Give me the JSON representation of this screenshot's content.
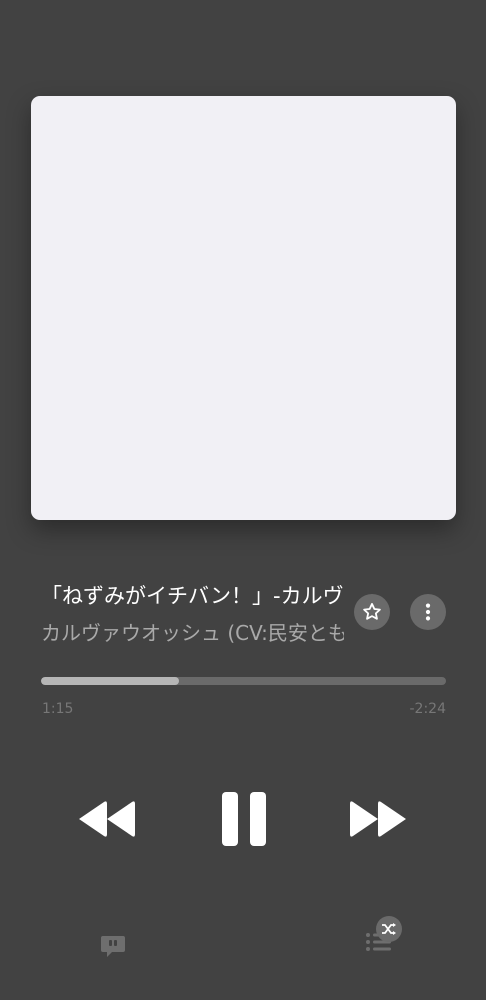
{
  "now_playing": {
    "title": "「ねずみがイチバン！」-カルヴァウオッシュ",
    "artist": "カルヴァウオッシュ (CV:民安ともえ)",
    "artwork_color": "#f1f0f5"
  },
  "progress": {
    "elapsed": "1:15",
    "remaining": "-2:24",
    "fraction": 0.34
  },
  "controls": {
    "favorite_icon": "star-icon",
    "more_icon": "more-vertical-icon",
    "rewind_icon": "rewind-icon",
    "pause_icon": "pause-icon",
    "fast_forward_icon": "fast-forward-icon",
    "lyrics_icon": "lyrics-speech-bubble-icon",
    "queue_icon": "queue-list-icon",
    "shuffle_icon": "shuffle-icon"
  },
  "colors": {
    "background": "#424242",
    "progress_fill": "#b6b6b6",
    "progress_track": "#6a6a6a"
  }
}
